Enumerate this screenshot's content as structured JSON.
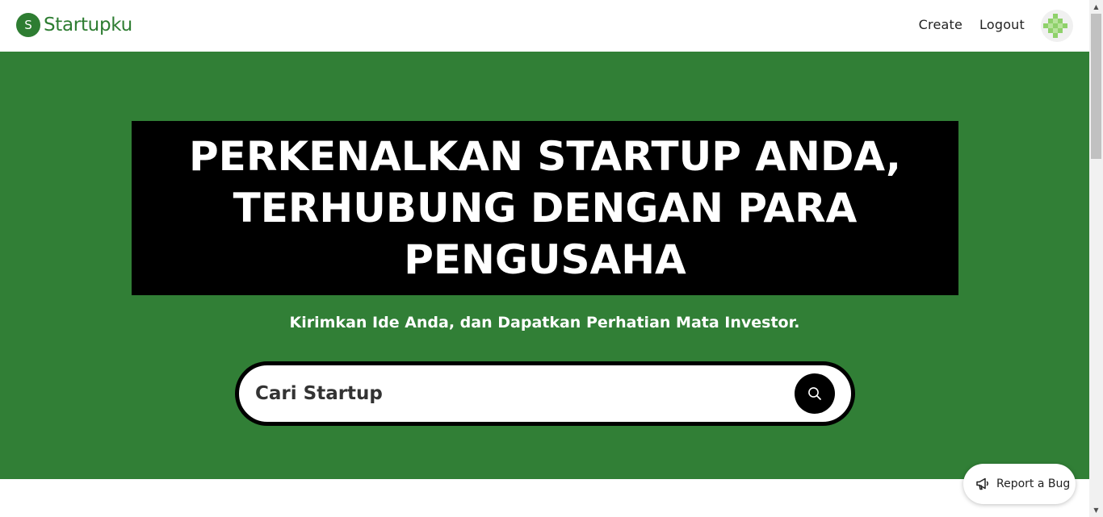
{
  "header": {
    "brand_letter": "S",
    "brand_name": "Startupku",
    "nav": [
      {
        "label": "Create"
      },
      {
        "label": "Logout"
      }
    ],
    "avatar_icon": "identicon-avatar"
  },
  "hero": {
    "headline": "PERKENALKAN STARTUP ANDA, TERHUBUNG DENGAN PARA PENGUSAHA",
    "subtitle": "Kirimkan Ide Anda, dan Dapatkan Perhatian Mata Investor.",
    "search": {
      "placeholder": "Cari Startup",
      "value": "",
      "button_icon": "search-icon"
    }
  },
  "report_bug": {
    "label": "Report a Bug",
    "icon": "megaphone-icon"
  },
  "colors": {
    "brand_green": "#2e7d32",
    "hero_green": "#317f36",
    "headline_bg": "#000000",
    "avatar_green": "#8fd16b"
  }
}
